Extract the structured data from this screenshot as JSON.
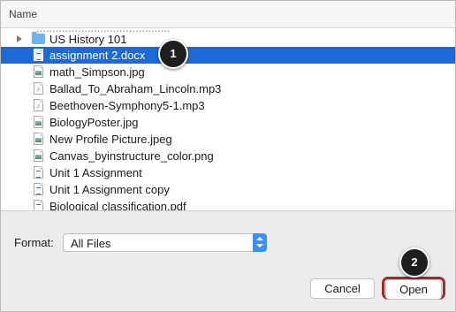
{
  "header": {
    "column_name": "Name"
  },
  "file_list": {
    "cut_off_top_text": "..........................................",
    "folder": {
      "label": "US History 101",
      "icon": "folder-icon"
    },
    "items": [
      {
        "label": "assignment 2.docx",
        "icon": "document-icon",
        "selected": true
      },
      {
        "label": "math_Simpson.jpg",
        "icon": "image-file-icon",
        "selected": false
      },
      {
        "label": "Ballad_To_Abraham_Lincoln.mp3",
        "icon": "audio-file-icon",
        "selected": false
      },
      {
        "label": "Beethoven-Symphony5-1.mp3",
        "icon": "audio-file-icon",
        "selected": false
      },
      {
        "label": "BiologyPoster.jpg",
        "icon": "image-file-icon",
        "selected": false
      },
      {
        "label": "New Profile Picture.jpeg",
        "icon": "image-file-icon",
        "selected": false
      },
      {
        "label": "Canvas_byinstructure_color.png",
        "icon": "image-file-icon",
        "selected": false
      },
      {
        "label": "Unit 1 Assignment",
        "icon": "document-icon",
        "selected": false
      },
      {
        "label": "Unit 1 Assignment copy",
        "icon": "document-icon",
        "selected": false
      },
      {
        "label": "Biological classification.pdf",
        "icon": "document-icon",
        "selected": false
      }
    ]
  },
  "format": {
    "label": "Format:",
    "value": "All Files"
  },
  "buttons": {
    "cancel": "Cancel",
    "open": "Open"
  },
  "callouts": {
    "first": "1",
    "second": "2"
  },
  "colors": {
    "selection": "#1b6ad8",
    "highlight_ring": "#a22a2a",
    "select_accent": "#3d8ff0"
  }
}
